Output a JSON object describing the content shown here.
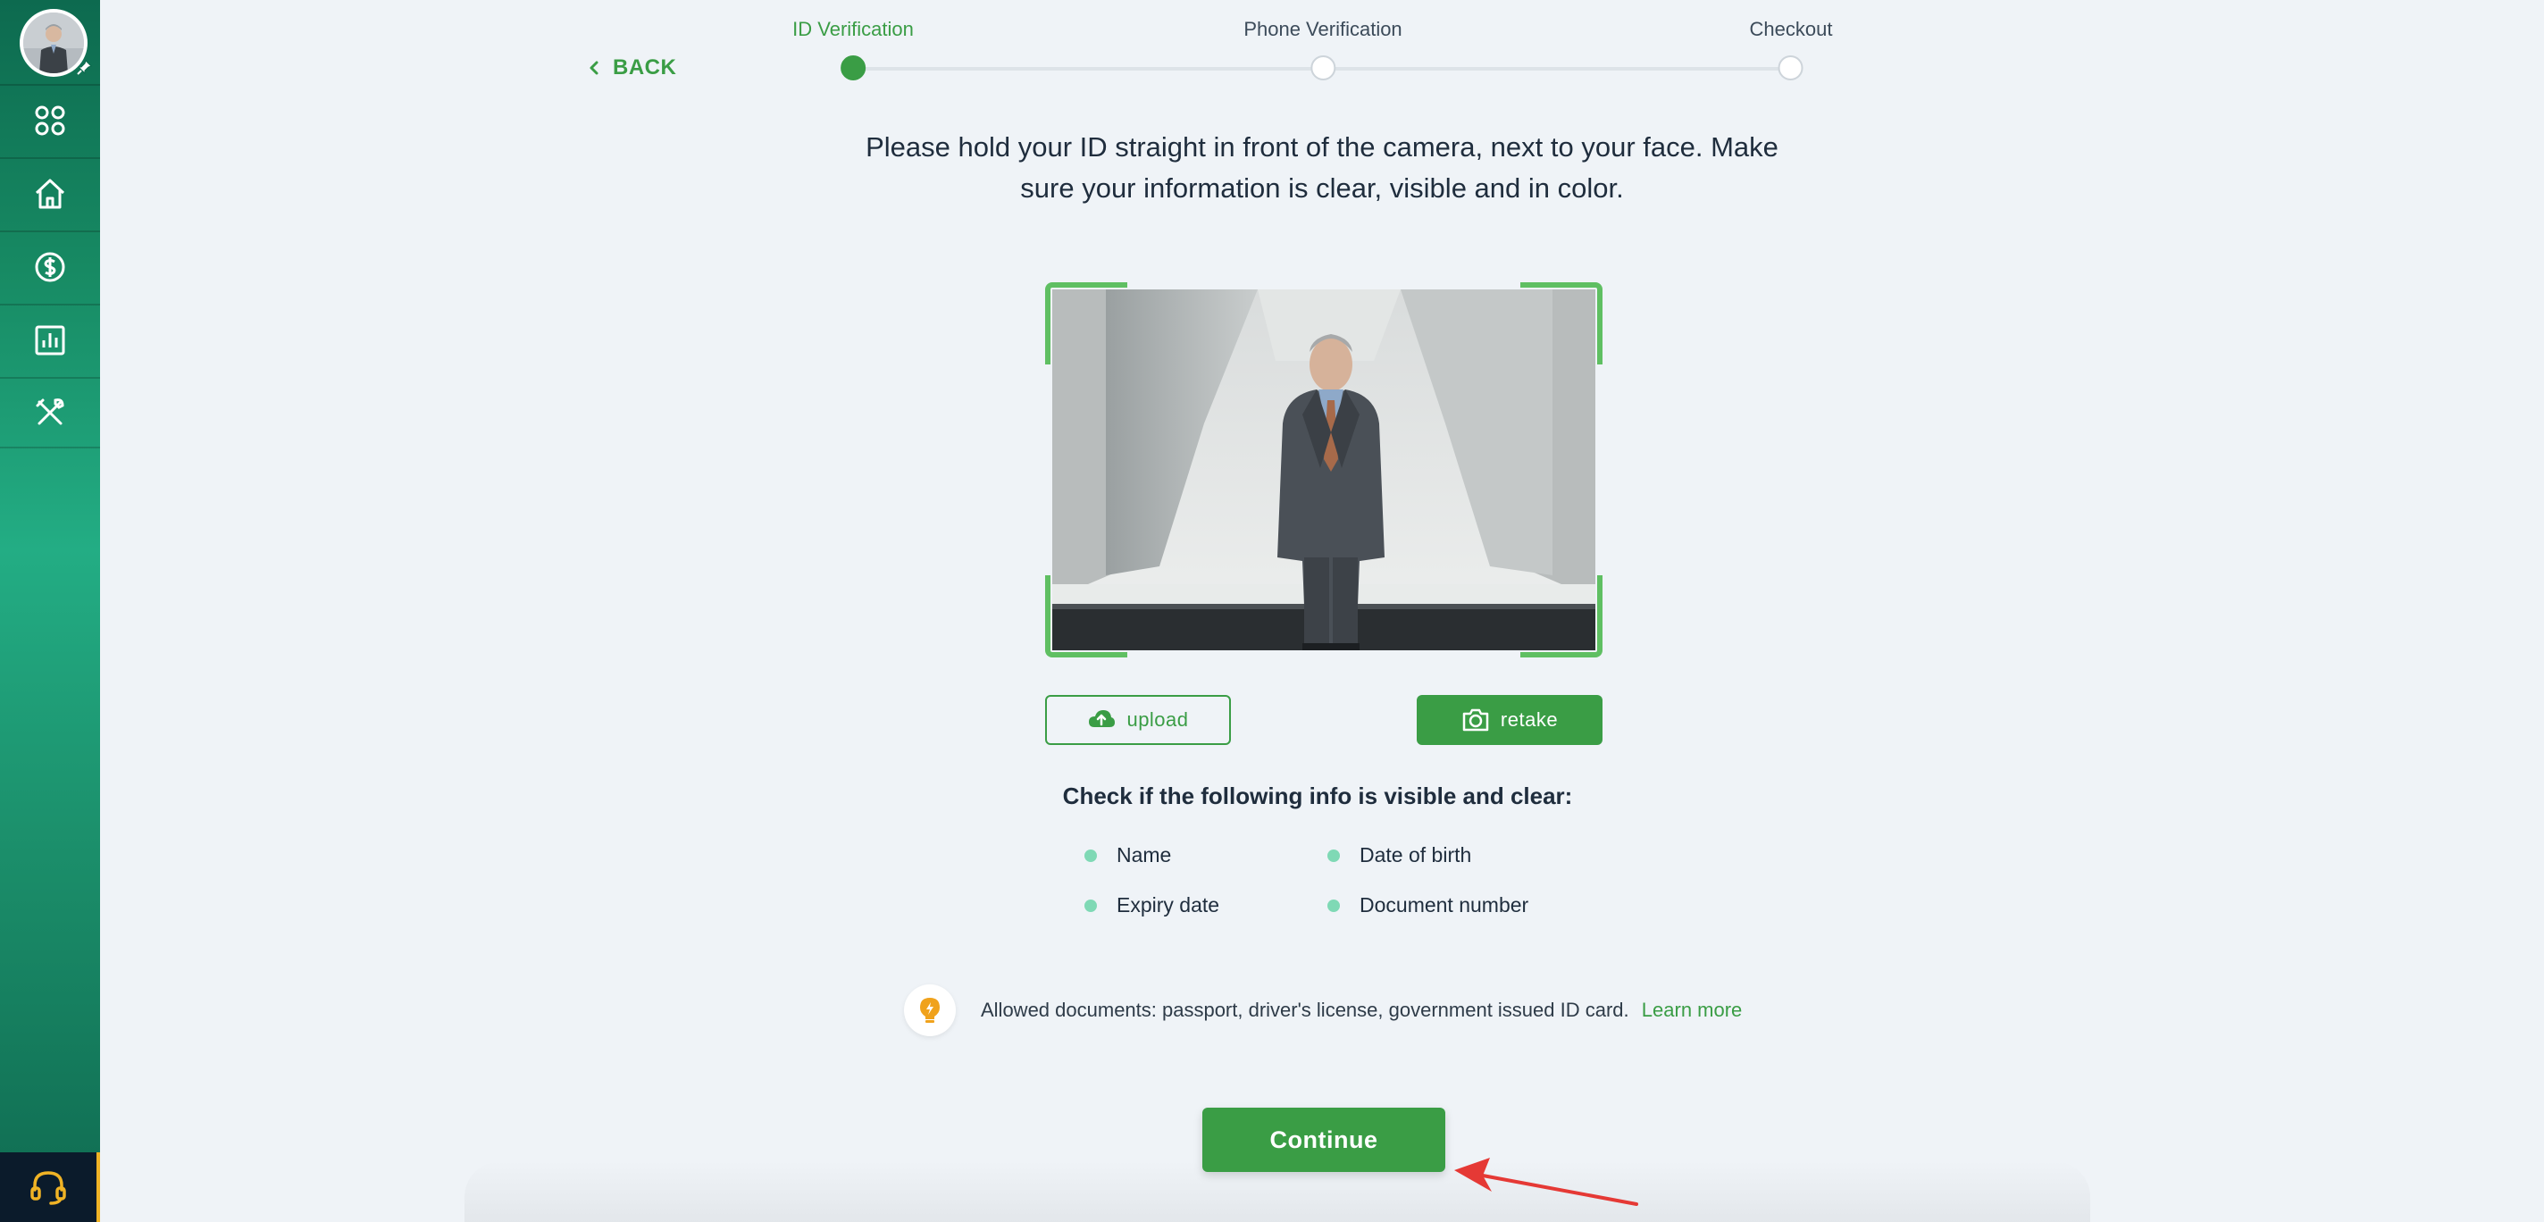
{
  "sidebar": {
    "items": [
      {
        "icon": "apps-grid-icon"
      },
      {
        "icon": "home-icon"
      },
      {
        "icon": "dollar-coin-icon"
      },
      {
        "icon": "bar-chart-icon"
      },
      {
        "icon": "tools-icon"
      }
    ],
    "support_icon": "headset-icon",
    "accent_color": "#f0b325"
  },
  "nav": {
    "back_label": "BACK"
  },
  "stepper": {
    "steps": [
      {
        "label": "ID Verification",
        "active": true
      },
      {
        "label": "Phone Verification",
        "active": false
      },
      {
        "label": "Checkout",
        "active": false
      }
    ]
  },
  "instruction": {
    "line1": "Please hold your ID straight in front of the camera, next to your face. Make",
    "line2": "sure your information is clear, visible and in color."
  },
  "actions": {
    "upload_label": "upload",
    "retake_label": "retake"
  },
  "checklist": {
    "title": "Check if the following info is visible and clear:",
    "items": [
      "Name",
      "Date of birth",
      "Expiry date",
      "Document number"
    ]
  },
  "allowed": {
    "text": "Allowed documents: passport, driver's license, government issued ID card.",
    "link": "Learn more"
  },
  "continue_label": "Continue",
  "colors": {
    "primary_green": "#3a9d45",
    "background": "#eff3f7",
    "annotation_arrow": "#e53935"
  }
}
